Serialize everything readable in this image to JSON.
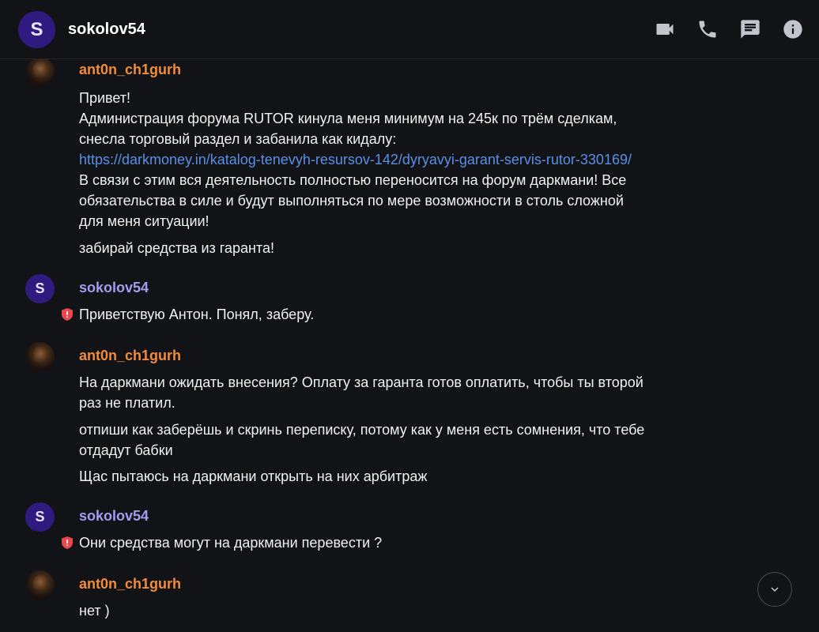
{
  "header": {
    "avatar_letter": "S",
    "name": "sokolov54",
    "icons": [
      "video-call-icon",
      "phone-icon",
      "chat-icon",
      "info-icon"
    ]
  },
  "messages": [
    {
      "author": "ant0n_ch1gurh",
      "lines": [
        "Привет!",
        "Администрация форума RUTOR кинула меня минимум на 245к по трём сделкам,",
        "снесла торговый раздел и забанила как кидалу:",
        "https://darkmoney.in/katalog-tenevyh-resursov-142/dyryavyi-garant-servis-rutor-330169/",
        "В связи с этим вся деятельность полностью переносится на форум даркмани! Все",
        "обязательства в силе и будут выполняться по мере возможности в столь сложной",
        "для меня ситуации!",
        "забирай средства из гаранта!"
      ]
    },
    {
      "author": "sokolov54",
      "avatar_letter": "S",
      "lines": [
        "Приветствую Антон. Понял, заберу."
      ]
    },
    {
      "author": "ant0n_ch1gurh",
      "lines": [
        "На даркмани ожидать внесения? Оплату за гаранта готов оплатить, чтобы ты второй",
        "раз не платил.",
        "отпиши как заберёшь и скринь переписку, потому как у меня есть сомнения, что тебе",
        "отдадут бабки",
        "Щас пытаюсь на даркмани открыть на них арбитраж"
      ]
    },
    {
      "author": "sokolov54",
      "avatar_letter": "S",
      "lines": [
        "Они средства могут на даркмани перевести ?"
      ]
    },
    {
      "author": "ant0n_ch1gurh",
      "lines": [
        "нет )"
      ]
    }
  ],
  "colors": {
    "background": "#121316",
    "author_orange": "#f28c3a",
    "author_purple": "#a59bf0",
    "link": "#5a8fe8",
    "avatar_purple": "#2f1b80",
    "shield_red": "#e5484d"
  },
  "scroll_button_icon": "chevron-down-icon"
}
